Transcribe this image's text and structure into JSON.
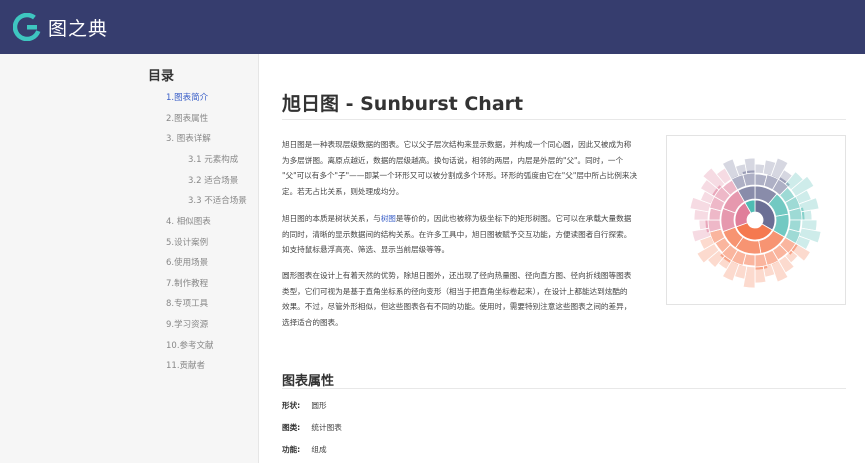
{
  "header": {
    "logo_text": "图之典",
    "logo_icon": "g-logo-icon",
    "bg_color": "#363d6e"
  },
  "sidebar": {
    "title": "目录",
    "items": [
      {
        "label": "1.图表简介",
        "active": true,
        "level": 1
      },
      {
        "label": "2.图表属性",
        "active": false,
        "level": 1
      },
      {
        "label": "3. 图表详解",
        "active": false,
        "level": 1
      },
      {
        "label": "3.1 元素构成",
        "active": false,
        "level": 2
      },
      {
        "label": "3.2 适合场景",
        "active": false,
        "level": 2
      },
      {
        "label": "3.3 不适合场景",
        "active": false,
        "level": 2
      },
      {
        "label": "4. 相似图表",
        "active": false,
        "level": 1
      },
      {
        "label": "5.设计案例",
        "active": false,
        "level": 1
      },
      {
        "label": "6.使用场景",
        "active": false,
        "level": 1
      },
      {
        "label": "7.制作教程",
        "active": false,
        "level": 1
      },
      {
        "label": "8.专项工具",
        "active": false,
        "level": 1
      },
      {
        "label": "9.学习资源",
        "active": false,
        "level": 1
      },
      {
        "label": "10.参考文献",
        "active": false,
        "level": 1
      },
      {
        "label": "11.贡献者",
        "active": false,
        "level": 1
      }
    ]
  },
  "main": {
    "title": "旭日图 - Sunburst Chart",
    "para1": {
      "l1": "旭日图是一种表现层级数据的图表。它以父子层次结构来显示数据，并构成一个同心圆，因此又被成为称",
      "l2": "为多层饼图。离原点越近，数据的层级越高。换句话说，相邻的两层，内层是外层的\"父\"。同时，一个",
      "l3": "\"父\"可以有多个\"子\"——即某一个环形又可以被分割成多个环形。环形的弧度由它在\"父\"层中所占比例来决",
      "l4": "定。若无占比关系，则处理成均分。"
    },
    "para2": {
      "l1a": "旭日图的本质是树状关系，与",
      "l1link": "树图",
      "l1b": "是等价的，因此也被称为极坐标下的矩形树图。它可以在承载大量数据",
      "l2": "的同时，清晰的显示数据间的结构关系。在许多工具中，旭日图被赋予交互功能，方便读图者自行探索。",
      "l3": "如支持鼠标悬浮高亮、筛选、显示当前层级等等。"
    },
    "para3": {
      "l1": "圆形图表在设计上有着天然的优势，除旭日图外，还出现了径向热量图、径向直方图、径向折线图等图表",
      "l2": "类型，它们可视为是基于直角坐标系的径向变形（相当于把直角坐标卷起来），在设计上都能达到炫酷的",
      "l3": "效果。不过，尽管外形相似，但这些图表各有不同的功能。使用时，需要特别注意这些图表之间的差异，",
      "l4": "选择适合的图表。"
    },
    "section_title": "图表属性",
    "props": [
      {
        "key": "形状:",
        "value": "圆形"
      },
      {
        "key": "图类:",
        "value": "统计图表"
      },
      {
        "key": "功能:",
        "value": "组成"
      }
    ]
  },
  "colors": {
    "orange": "#f5794f",
    "teal": "#4fbcb3",
    "pink": "#e07e9a",
    "slate": "#6b6f95",
    "accent": "#3a5fc8"
  }
}
